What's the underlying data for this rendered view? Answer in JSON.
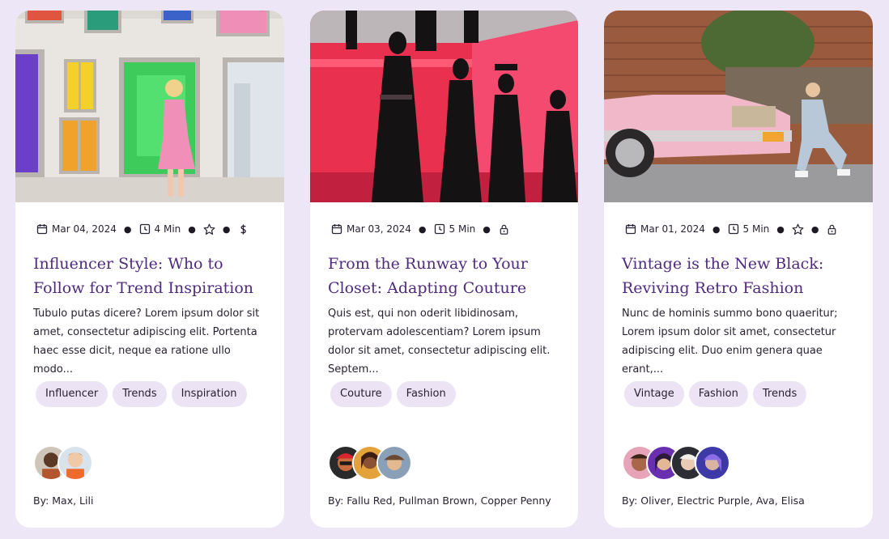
{
  "cards": [
    {
      "date": "Mar 04, 2024",
      "read_time": "4 Min",
      "badges": [
        "star-icon",
        "dollar-icon"
      ],
      "title": "Influencer Style: Who to Follow for Trend Inspiration",
      "excerpt": "Tubulo putas dicere? Lorem ipsum dolor sit amet, consectetur adipiscing elit. Portenta haec esse dicit, neque ea ratione ullo modo...",
      "tags": [
        "Influencer",
        "Trends",
        "Inspiration"
      ],
      "byline": "By: Max, Lili"
    },
    {
      "date": "Mar 03, 2024",
      "read_time": "5 Min",
      "badges": [
        "lock-icon"
      ],
      "title": "From the Runway to Your Closet: Adapting Couture",
      "excerpt": "Quis est, qui non oderit libidinosam, protervam adolescentiam? Lorem ipsum dolor sit amet, consectetur adipiscing elit. Septem...",
      "tags": [
        "Couture",
        "Fashion"
      ],
      "byline": "By: Fallu Red, Pullman Brown, Copper Penny"
    },
    {
      "date": "Mar 01, 2024",
      "read_time": "5 Min",
      "badges": [
        "star-icon",
        "lock-icon"
      ],
      "title": "Vintage is the New Black: Reviving Retro Fashion",
      "excerpt": "Nunc de hominis summo bono quaeritur; Lorem ipsum dolor sit amet, consectetur adipiscing elit. Duo enim genera quae erant,...",
      "tags": [
        "Vintage",
        "Fashion",
        "Trends"
      ],
      "byline": "By: Oliver, Electric Purple, Ava, Elisa"
    }
  ],
  "colors": {
    "page_background": "#ede6f6",
    "title": "#4f2a7e",
    "tag_background": "#ece4f5"
  }
}
